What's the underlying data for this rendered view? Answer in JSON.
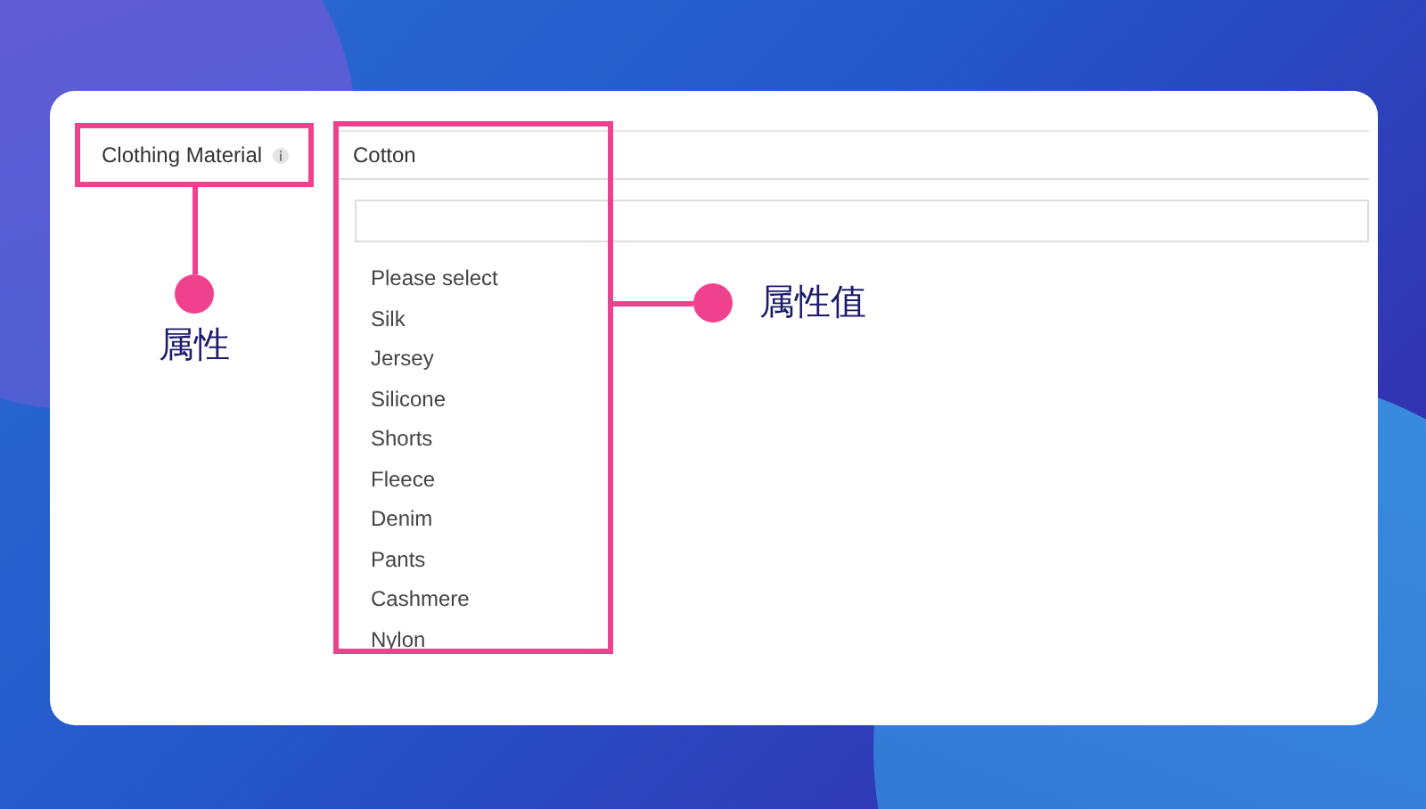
{
  "attribute": {
    "label": "Clothing Material"
  },
  "dropdown": {
    "value": "Cotton",
    "options": [
      "Please select",
      "Silk",
      "Jersey",
      "Silicone",
      "Shorts",
      "Fleece",
      "Denim",
      "Pants",
      "Cashmere",
      "Nylon"
    ]
  },
  "annotations": [
    {
      "text": "属性"
    },
    {
      "text": "属性值"
    }
  ]
}
